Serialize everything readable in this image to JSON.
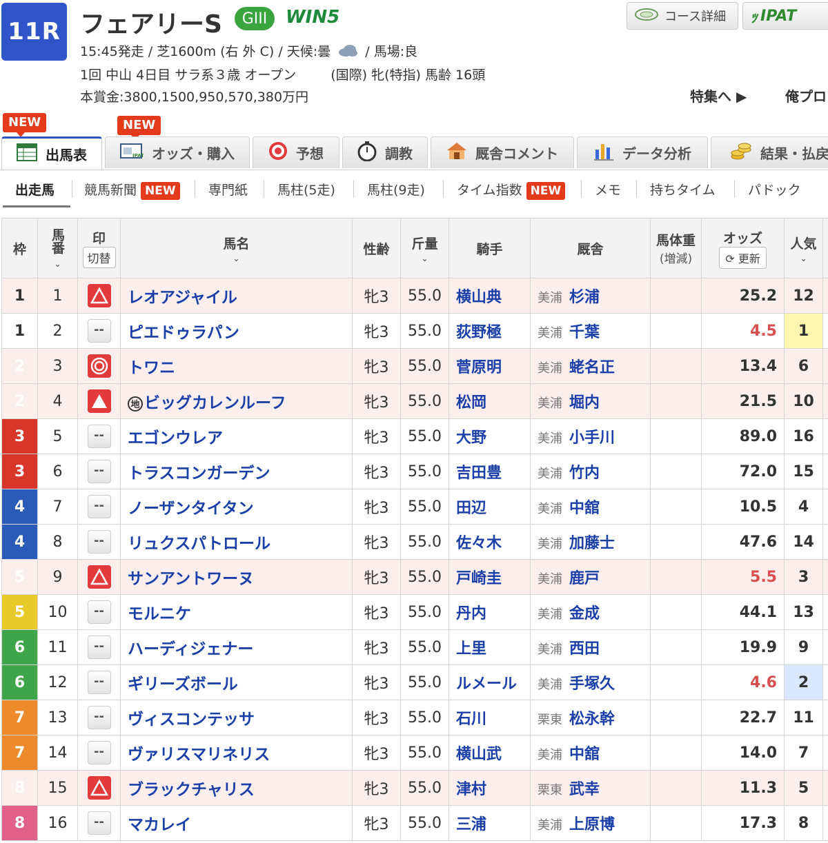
{
  "race": {
    "number": "11R",
    "title": "フェアリーS",
    "grade": "GIII",
    "win5": "WIN5",
    "line1_pre": "15:45発走 / 芝1600m (右 外 C) / 天候:曇",
    "line1_post": "/ 馬場:良",
    "line2a": "1回 中山 4日目 サラ系３歳 オープン",
    "line2b": "(国際) 牝(特指) 馬齢 16頭",
    "prize": "本賞金:3800,1500,950,570,380万円"
  },
  "header_buttons": {
    "course": "コース詳細",
    "ipat": "IPAT",
    "special": "特集へ ▶",
    "ore": "俺プロ"
  },
  "tabs": [
    {
      "label": "出馬表",
      "new": "NEW"
    },
    {
      "label": "オッズ・購入",
      "new": "NEW"
    },
    {
      "label": "予想"
    },
    {
      "label": "調教"
    },
    {
      "label": "厩舎コメント"
    },
    {
      "label": "データ分析"
    },
    {
      "label": "結果・払戻"
    }
  ],
  "subnav": [
    {
      "label": "出走馬"
    },
    {
      "label": "競馬新聞",
      "new": "NEW"
    },
    {
      "label": "専門紙"
    },
    {
      "label": "馬柱(5走)"
    },
    {
      "label": "馬柱(9走)"
    },
    {
      "label": "タイム指数",
      "new": "NEW"
    },
    {
      "label": "メモ"
    },
    {
      "label": "持ちタイム"
    },
    {
      "label": "パドック"
    }
  ],
  "table_header": {
    "waku": "枠",
    "umaban": "馬番",
    "mark": "印",
    "mark_toggle": "切替",
    "name": "馬名",
    "sexage": "性齢",
    "kinryo": "斤量",
    "jockey": "騎手",
    "trainer": "厩舎",
    "weight": "馬体重",
    "weight_sub": "(増減)",
    "odds": "オッズ",
    "odds_update": "更新",
    "ninki": "人気"
  },
  "horses": [
    {
      "waku": "1",
      "umaban": "1",
      "mark": "triangle-outline",
      "name": "レオアジャイル",
      "sexage": "牝3",
      "kinryo": "55.0",
      "jockey": "横山典",
      "area": "美浦",
      "trainer": "杉浦",
      "odds": "25.2",
      "ninki": "12",
      "hot": false
    },
    {
      "waku": "1",
      "umaban": "2",
      "mark": "none",
      "name": "ピエドゥラパン",
      "sexage": "牝3",
      "kinryo": "55.0",
      "jockey": "荻野極",
      "area": "美浦",
      "trainer": "千葉",
      "odds": "4.5",
      "ninki": "1",
      "hot": true
    },
    {
      "waku": "2",
      "umaban": "3",
      "mark": "double-circle",
      "name": "トワニ",
      "sexage": "牝3",
      "kinryo": "55.0",
      "jockey": "菅原明",
      "area": "美浦",
      "trainer": "蛯名正",
      "odds": "13.4",
      "ninki": "6",
      "hot": false
    },
    {
      "waku": "2",
      "umaban": "4",
      "mark": "triangle-filled",
      "name": "ビッグカレンルーフ",
      "chi": "地",
      "sexage": "牝3",
      "kinryo": "55.0",
      "jockey": "松岡",
      "area": "美浦",
      "trainer": "堀内",
      "odds": "21.5",
      "ninki": "10",
      "hot": false
    },
    {
      "waku": "3",
      "umaban": "5",
      "mark": "none",
      "name": "エゴンウレア",
      "sexage": "牝3",
      "kinryo": "55.0",
      "jockey": "大野",
      "area": "美浦",
      "trainer": "小手川",
      "odds": "89.0",
      "ninki": "16",
      "hot": false
    },
    {
      "waku": "3",
      "umaban": "6",
      "mark": "none",
      "name": "トラスコンガーデン",
      "sexage": "牝3",
      "kinryo": "55.0",
      "jockey": "吉田豊",
      "area": "美浦",
      "trainer": "竹内",
      "odds": "72.0",
      "ninki": "15",
      "hot": false
    },
    {
      "waku": "4",
      "umaban": "7",
      "mark": "none",
      "name": "ノーザンタイタン",
      "sexage": "牝3",
      "kinryo": "55.0",
      "jockey": "田辺",
      "area": "美浦",
      "trainer": "中舘",
      "odds": "10.5",
      "ninki": "4",
      "hot": false
    },
    {
      "waku": "4",
      "umaban": "8",
      "mark": "none",
      "name": "リュクスパトロール",
      "sexage": "牝3",
      "kinryo": "55.0",
      "jockey": "佐々木",
      "area": "美浦",
      "trainer": "加藤士",
      "odds": "47.6",
      "ninki": "14",
      "hot": false
    },
    {
      "waku": "5",
      "umaban": "9",
      "mark": "triangle-outline",
      "name": "サンアントワーヌ",
      "sexage": "牝3",
      "kinryo": "55.0",
      "jockey": "戸崎圭",
      "area": "美浦",
      "trainer": "鹿戸",
      "odds": "5.5",
      "ninki": "3",
      "hot": true
    },
    {
      "waku": "5",
      "umaban": "10",
      "mark": "none",
      "name": "モルニケ",
      "sexage": "牝3",
      "kinryo": "55.0",
      "jockey": "丹内",
      "area": "美浦",
      "trainer": "金成",
      "odds": "44.1",
      "ninki": "13",
      "hot": false
    },
    {
      "waku": "6",
      "umaban": "11",
      "mark": "none",
      "name": "ハーディジェナー",
      "sexage": "牝3",
      "kinryo": "55.0",
      "jockey": "上里",
      "area": "美浦",
      "trainer": "西田",
      "odds": "19.9",
      "ninki": "9",
      "hot": false
    },
    {
      "waku": "6",
      "umaban": "12",
      "mark": "none",
      "name": "ギリーズボール",
      "sexage": "牝3",
      "kinryo": "55.0",
      "jockey": "ルメール",
      "area": "美浦",
      "trainer": "手塚久",
      "odds": "4.6",
      "ninki": "2",
      "hot": true
    },
    {
      "waku": "7",
      "umaban": "13",
      "mark": "none",
      "name": "ヴィスコンテッサ",
      "sexage": "牝3",
      "kinryo": "55.0",
      "jockey": "石川",
      "area": "栗東",
      "trainer": "松永幹",
      "odds": "22.7",
      "ninki": "11",
      "hot": false
    },
    {
      "waku": "7",
      "umaban": "14",
      "mark": "none",
      "name": "ヴァリスマリネリス",
      "sexage": "牝3",
      "kinryo": "55.0",
      "jockey": "横山武",
      "area": "美浦",
      "trainer": "中舘",
      "odds": "14.0",
      "ninki": "7",
      "hot": false
    },
    {
      "waku": "8",
      "umaban": "15",
      "mark": "triangle-outline",
      "name": "ブラックチャリス",
      "sexage": "牝3",
      "kinryo": "55.0",
      "jockey": "津村",
      "area": "栗東",
      "trainer": "武幸",
      "odds": "11.3",
      "ninki": "5",
      "hot": false
    },
    {
      "waku": "8",
      "umaban": "16",
      "mark": "none",
      "name": "マカレイ",
      "sexage": "牝3",
      "kinryo": "55.0",
      "jockey": "三浦",
      "area": "美浦",
      "trainer": "上原博",
      "odds": "17.3",
      "ninki": "8",
      "hot": false
    }
  ],
  "colors": {
    "accent": "#2f55c8",
    "new_badge": "#e43a1c",
    "link": "#1a3fa8",
    "hot_odds": "#d94e4e"
  }
}
